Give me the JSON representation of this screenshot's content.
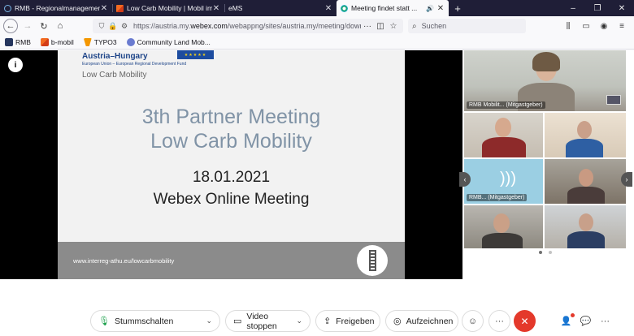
{
  "tabs": [
    {
      "title": "RMB - Regionalmanagement B",
      "icon": "rmb-favicon",
      "active": false
    },
    {
      "title": "Low Carb Mobility | Mobil im B",
      "icon": "lcm-favicon",
      "active": false
    },
    {
      "title": "eMS",
      "icon": "",
      "active": false
    },
    {
      "title": "Meeting findet statt ...",
      "icon": "webex-favicon",
      "active": true
    }
  ],
  "browser": {
    "new_tab": "+",
    "minimize": "–",
    "maximize": "❐",
    "close": "✕",
    "url_prefix": "https://austria.my.",
    "url_domain": "webex.com",
    "url_suffix": "/webappng/sites/austria.my/meeting/downlo",
    "url_more": "···",
    "search_placeholder": "Suchen"
  },
  "bookmarks": [
    {
      "label": "RMB",
      "icon": "rmb"
    },
    {
      "label": "b-mobil",
      "icon": "bm-b"
    },
    {
      "label": "TYPO3",
      "icon": "typo"
    },
    {
      "label": "Community Land Mob...",
      "icon": "clm"
    }
  ],
  "slide": {
    "brand": "Austria–Hungary",
    "fund": "European Union – European Regional Development Fund",
    "project": "Low Carb Mobility",
    "title_line1": "3th Partner Meeting",
    "title_line2": "Low Carb Mobility",
    "date": "18.01.2021",
    "subtitle": "Webex Online Meeting",
    "website": "www.interreg-athu.eu/lowcarbmobility"
  },
  "info_label": "i",
  "participants": {
    "main_caption": "RMB Mobilit... (Mitgastgeber)",
    "tile_c_caption": "RMB... (Mitgastgeber)"
  },
  "controls": {
    "mute": "Stummschalten",
    "video": "Video stoppen",
    "share": "Freigeben",
    "record": "Aufzeichnen"
  },
  "colors": {
    "end_call": "#e4392b",
    "slide_title": "#8093a6",
    "mic_active": "#1a9f4a",
    "tab_bar": "#1f1e37"
  }
}
